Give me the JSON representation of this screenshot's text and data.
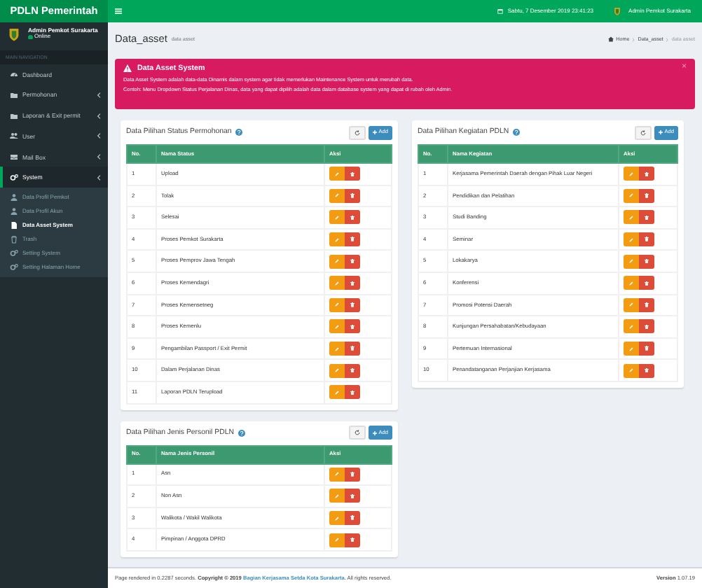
{
  "header": {
    "brand": "PDLN Pemerintah",
    "datetime": "Sabtu, 7 Desember 2019 23:41:23",
    "user": "Admin Pemkot Surakarta"
  },
  "sidebar": {
    "user": {
      "name": "Admin Pemkot Surakarta",
      "status": "Online"
    },
    "nav_label": "MAIN NAVIGATION",
    "items": [
      {
        "label": "Dashboard",
        "kind": "link",
        "selected": false
      },
      {
        "label": "Permohonan",
        "kind": "menu",
        "selected": false
      },
      {
        "label": "Laporan & Exit permit",
        "kind": "menu",
        "selected": false
      },
      {
        "label": "User",
        "kind": "menu",
        "selected": false
      },
      {
        "label": "Mail Box",
        "kind": "menu",
        "selected": false
      },
      {
        "label": "System",
        "kind": "menu",
        "selected": true,
        "expanded": true,
        "children": [
          {
            "label": "Data Profil Pemkot",
            "selected": false
          },
          {
            "label": "Data Profil Akun",
            "selected": false
          },
          {
            "label": "Data Asset System",
            "selected": true
          },
          {
            "label": "Trash",
            "selected": false
          },
          {
            "label": "Setting System",
            "selected": false
          },
          {
            "label": "Setting Halaman Home",
            "selected": false
          }
        ]
      }
    ]
  },
  "page": {
    "title": "Data_asset",
    "subtitle": "data asset",
    "breadcrumb": [
      "Home",
      "Data_asset",
      "data asset"
    ]
  },
  "alert": {
    "title": "Data Asset System",
    "close": "×",
    "lines": [
      "Data Asset System adalah data-data Dinamis dalam system agar tidak memerlukan Maintenance System untuk merubah data.",
      "Contoh: Menu Dropdown Status Perjalanan Dinas, data yang dapat dipilih adalah data dalam database system yang dapat di rubah oleh Admin."
    ]
  },
  "cards": [
    {
      "title": "Data Pilihan Status Permohonan",
      "add_label": "Add",
      "columns": [
        "No.",
        "Nama Status",
        "Aksi"
      ],
      "rows": [
        {
          "no": "1",
          "name": "Upload"
        },
        {
          "no": "2",
          "name": "Tolak"
        },
        {
          "no": "3",
          "name": "Selesai"
        },
        {
          "no": "4",
          "name": "Proses Pemkot Surakarta"
        },
        {
          "no": "5",
          "name": "Proses Pemprov Jawa Tengah"
        },
        {
          "no": "6",
          "name": "Proses Kemendagri"
        },
        {
          "no": "7",
          "name": "Proses Kemensetneg"
        },
        {
          "no": "8",
          "name": "Proses Kemenlu"
        },
        {
          "no": "9",
          "name": "Pengambilan Passport / Exit Permit"
        },
        {
          "no": "10",
          "name": "Dalam Perjalanan Dinas"
        },
        {
          "no": "11",
          "name": "Laporan PDLN Terupload"
        }
      ]
    },
    {
      "title": "Data Pilihan Kegiatan PDLN",
      "add_label": "Add",
      "columns": [
        "No.",
        "Nama Kegiatan",
        "Aksi"
      ],
      "rows": [
        {
          "no": "1",
          "name": "Kerjasama Pemerintah Daerah dengan Pihak Luar Negeri"
        },
        {
          "no": "2",
          "name": "Pendidikan dan Pelatihan"
        },
        {
          "no": "3",
          "name": "Studi Banding"
        },
        {
          "no": "4",
          "name": "Seminar"
        },
        {
          "no": "5",
          "name": "Lokakarya"
        },
        {
          "no": "6",
          "name": "Konferensi"
        },
        {
          "no": "7",
          "name": "Promosi Potensi Daerah"
        },
        {
          "no": "8",
          "name": "Kunjungan Persahabatan/Kebudayaan"
        },
        {
          "no": "9",
          "name": "Pertemuan Internasional"
        },
        {
          "no": "10",
          "name": "Penandatanganan Perjanjian Kerjasama"
        }
      ]
    },
    {
      "title": "Data Pilihan Jenis Personil PDLN",
      "add_label": "Add",
      "columns": [
        "No.",
        "Nama Jenis Personil",
        "Aksi"
      ],
      "rows": [
        {
          "no": "1",
          "name": "Asn"
        },
        {
          "no": "2",
          "name": "Non Asn"
        },
        {
          "no": "3",
          "name": "Walikota / Wakil Walikota"
        },
        {
          "no": "4",
          "name": "Pimpinan / Anggota DPRD"
        }
      ]
    }
  ],
  "footer": {
    "text": "Page rendered in 0.2287 seconds. **Copyright © 2019**",
    "link": "Bagian Kerjasama Setda Kota Surakarta.",
    "rest": "All rights reserved.",
    "version": "**Version** 1.07.19"
  }
}
